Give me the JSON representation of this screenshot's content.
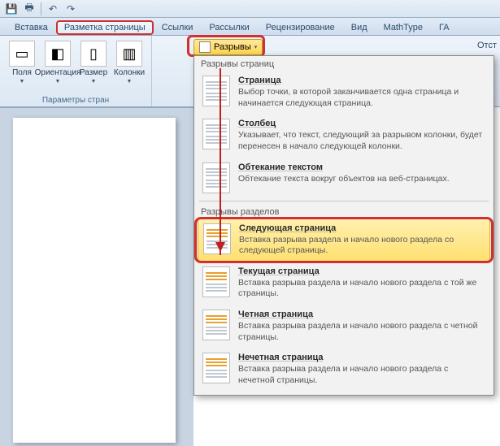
{
  "qat_icons": [
    "save-icon",
    "print-icon",
    "divider",
    "undo-icon",
    "redo-icon"
  ],
  "tabs": {
    "items": [
      "Вставка",
      "Разметка страницы",
      "Ссылки",
      "Рассылки",
      "Рецензирование",
      "Вид",
      "MathType",
      "ГА"
    ],
    "active_index": 1
  },
  "ribbon": {
    "page_setup_label": "Параметры стран",
    "margins": "Поля",
    "orientation": "Ориентация",
    "size": "Размер",
    "columns": "Колонки",
    "breaks_button": "Разрывы",
    "right_partial": "Отст"
  },
  "breaks_menu": {
    "section1_header": "Разрывы страниц",
    "items1": [
      {
        "title": "Страница",
        "desc": "Выбор точки, в которой заканчивается одна страница и начинается следующая страница."
      },
      {
        "title": "Столбец",
        "desc": "Указывает, что текст, следующий за разрывом колонки, будет перенесен в начало следующей колонки."
      },
      {
        "title": "Обтекание текстом",
        "desc": "Обтекание текста вокруг объектов на веб-страницах."
      }
    ],
    "section2_header": "Разрывы разделов",
    "items2": [
      {
        "title": "Следующая страница",
        "desc": "Вставка разрыва раздела и начало нового раздела со следующей страницы."
      },
      {
        "title": "Текущая страница",
        "desc": "Вставка разрыва раздела и начало нового раздела с той же страницы."
      },
      {
        "title": "Четная страница",
        "desc": "Вставка разрыва раздела и начало нового раздела с четной страницы."
      },
      {
        "title": "Нечетная страница",
        "desc": "Вставка разрыва раздела и начало нового раздела с нечетной страницы."
      }
    ]
  }
}
